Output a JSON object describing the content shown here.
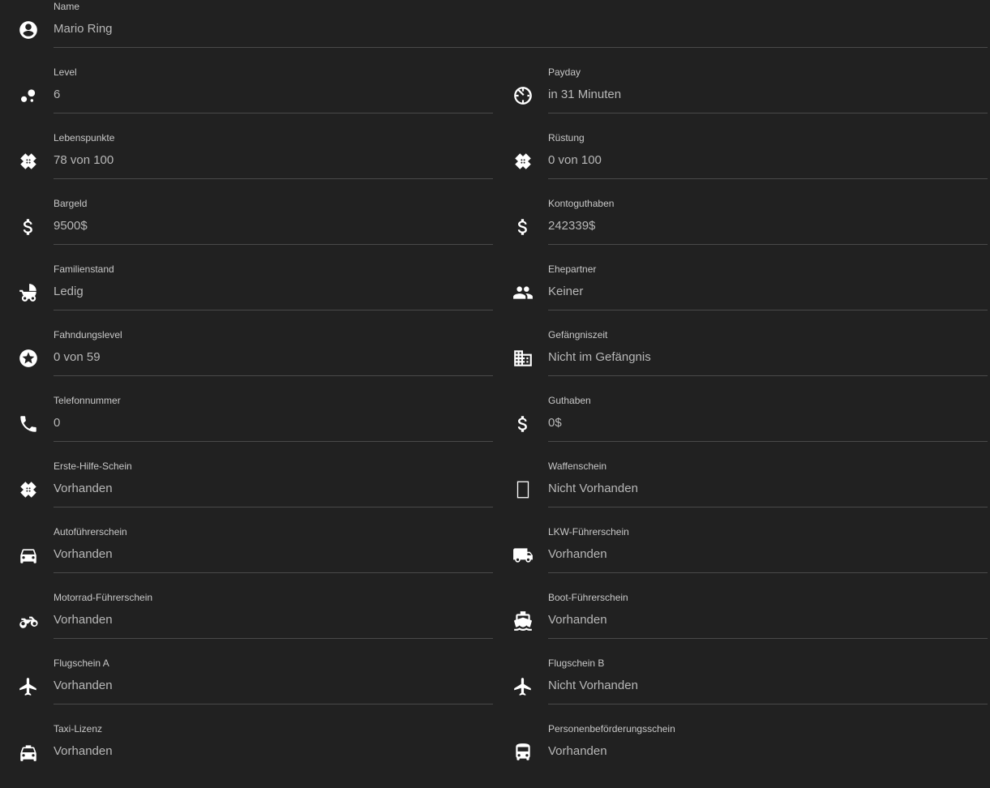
{
  "fields": {
    "name": {
      "label": "Name",
      "value": "Mario Ring",
      "icon": "account-circle-icon"
    },
    "level": {
      "label": "Level",
      "value": "6",
      "icon": "bubbles-icon"
    },
    "payday": {
      "label": "Payday",
      "value": "in 31 Minuten",
      "icon": "timer-icon"
    },
    "lebenspunkte": {
      "label": "Lebenspunkte",
      "value": "78 von 100",
      "icon": "bandage-icon"
    },
    "ruestung": {
      "label": "Rüstung",
      "value": "0 von 100",
      "icon": "bandage-icon"
    },
    "bargeld": {
      "label": "Bargeld",
      "value": "9500$",
      "icon": "dollar-icon"
    },
    "kontoguthaben": {
      "label": "Kontoguthaben",
      "value": "242339$",
      "icon": "dollar-icon"
    },
    "familienstand": {
      "label": "Familienstand",
      "value": "Ledig",
      "icon": "baby-carriage-icon"
    },
    "ehepartner": {
      "label": "Ehepartner",
      "value": "Keiner",
      "icon": "people-icon"
    },
    "fahndungslevel": {
      "label": "Fahndungslevel",
      "value": "0 von 59",
      "icon": "star-circle-icon"
    },
    "gefaengniszeit": {
      "label": "Gefängniszeit",
      "value": "Nicht im Gefängnis",
      "icon": "building-icon"
    },
    "telefonnummer": {
      "label": "Telefonnummer",
      "value": "0",
      "icon": "phone-icon"
    },
    "guthaben": {
      "label": "Guthaben",
      "value": "0$",
      "icon": "dollar-icon"
    },
    "erste_hilfe": {
      "label": "Erste-Hilfe-Schein",
      "value": "Vorhanden",
      "icon": "bandage-icon"
    },
    "waffenschein": {
      "label": "Waffenschein",
      "value": "Nicht Vorhanden",
      "icon": "missing-glyph-icon"
    },
    "auto": {
      "label": "Autoführerschein",
      "value": "Vorhanden",
      "icon": "car-icon"
    },
    "lkw": {
      "label": "LKW-Führerschein",
      "value": "Vorhanden",
      "icon": "truck-icon"
    },
    "motorrad": {
      "label": "Motorrad-Führerschein",
      "value": "Vorhanden",
      "icon": "motorbike-icon"
    },
    "boot": {
      "label": "Boot-Führerschein",
      "value": "Vorhanden",
      "icon": "ferry-icon"
    },
    "flug_a": {
      "label": "Flugschein A",
      "value": "Vorhanden",
      "icon": "airplane-icon"
    },
    "flug_b": {
      "label": "Flugschein B",
      "value": "Nicht Vorhanden",
      "icon": "airplane-icon"
    },
    "taxi": {
      "label": "Taxi-Lizenz",
      "value": "Vorhanden",
      "icon": "taxi-icon"
    },
    "personen": {
      "label": "Personenbeförderungsschein",
      "value": "Vorhanden",
      "icon": "bus-icon"
    }
  },
  "colors": {
    "background": "#212121",
    "label": "#c8c8c8",
    "value": "#b8b8b8",
    "divider": "#4a4a4a",
    "icon": "#ffffff"
  }
}
